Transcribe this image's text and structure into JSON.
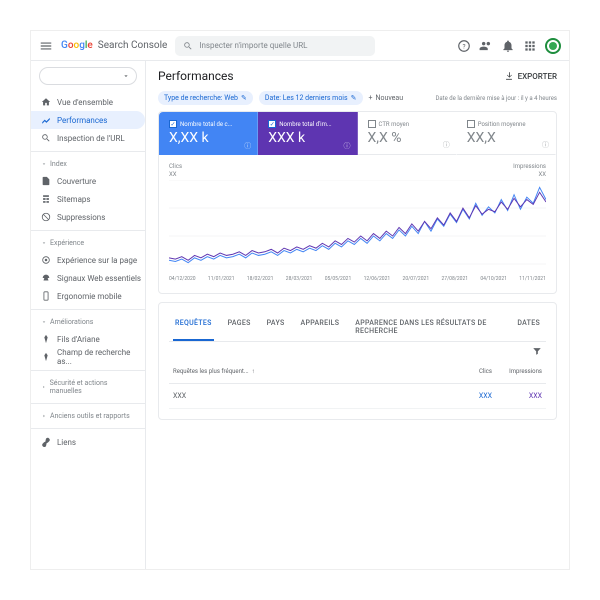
{
  "header": {
    "product": "Search Console",
    "search_placeholder": "Inspecter n'importe quelle URL"
  },
  "sidebar": {
    "items": [
      {
        "label": "Vue d'ensemble"
      },
      {
        "label": "Performances"
      },
      {
        "label": "Inspection de l'URL"
      }
    ],
    "sec_index": "Index",
    "index_items": [
      {
        "label": "Couverture"
      },
      {
        "label": "Sitemaps"
      },
      {
        "label": "Suppressions"
      }
    ],
    "sec_exp": "Expérience",
    "exp_items": [
      {
        "label": "Expérience sur la page"
      },
      {
        "label": "Signaux Web essentiels"
      },
      {
        "label": "Ergonomie mobile"
      }
    ],
    "sec_amel": "Améliorations",
    "amel_items": [
      {
        "label": "Fils d'Ariane"
      },
      {
        "label": "Champ de recherche as..."
      }
    ],
    "sec_sec": "Sécurité et actions manuelles",
    "sec_old": "Anciens outils et rapports",
    "liens": "Liens"
  },
  "page": {
    "title": "Performances",
    "export": "EXPORTER"
  },
  "filters": {
    "chips": [
      {
        "label": "Type de recherche: Web"
      },
      {
        "label": "Date: Les 12 derniers mois"
      }
    ],
    "new": "Nouveau",
    "updated": "Date de la dernière mise à jour : il y a 4 heures"
  },
  "metrics": [
    {
      "label": "Nombre total de c...",
      "value": "X,XX k",
      "checked": true
    },
    {
      "label": "Nombre total d'im...",
      "value": "XXX k",
      "checked": true
    },
    {
      "label": "CTR moyen",
      "value": "X,X %",
      "checked": false
    },
    {
      "label": "Position moyenne",
      "value": "XX,X",
      "checked": false
    }
  ],
  "chart_data": {
    "type": "line",
    "left_label": "Clics",
    "right_label": "Impressions",
    "left_unit": "XX",
    "right_unit": "XX",
    "x_ticks": [
      "04/12/2020",
      "11/01/2021",
      "18/02/2021",
      "28/03/2021",
      "05/05/2021",
      "12/06/2021",
      "20/07/2021",
      "27/08/2021",
      "04/10/2021",
      "11/11/2021"
    ],
    "series": [
      {
        "name": "Clics",
        "color": "#4285f4",
        "values": [
          8,
          7,
          9,
          6,
          10,
          8,
          11,
          9,
          12,
          10,
          11,
          13,
          10,
          14,
          12,
          13,
          15,
          12,
          16,
          14,
          17,
          15,
          18,
          16,
          20,
          17,
          22,
          19,
          24,
          21,
          26,
          22,
          28,
          24,
          30,
          26,
          33,
          28,
          36,
          30,
          40,
          32,
          42,
          36,
          46,
          39,
          50,
          42,
          55,
          45,
          52,
          47,
          58,
          49,
          62,
          50,
          60,
          55,
          68,
          58
        ]
      },
      {
        "name": "Impressions",
        "color": "#5e35b1",
        "values": [
          10,
          9,
          11,
          8,
          12,
          10,
          13,
          11,
          14,
          12,
          13,
          15,
          12,
          16,
          14,
          15,
          17,
          14,
          18,
          16,
          19,
          17,
          20,
          18,
          22,
          19,
          24,
          21,
          26,
          23,
          28,
          24,
          30,
          26,
          32,
          28,
          35,
          30,
          38,
          32,
          40,
          34,
          43,
          37,
          47,
          40,
          51,
          43,
          53,
          46,
          50,
          48,
          56,
          50,
          59,
          52,
          58,
          54,
          64,
          56
        ]
      }
    ],
    "ylim": [
      0,
      70
    ]
  },
  "tabs": [
    "REQUÊTES",
    "PAGES",
    "PAYS",
    "APPAREILS",
    "APPARENCE DANS LES RÉSULTATS DE RECHERCHE",
    "DATES"
  ],
  "table": {
    "h1": "Requêtes les plus fréquent...",
    "h2": "Clics",
    "h3": "Impressions",
    "rows": [
      {
        "q": "XXX",
        "c": "XXX",
        "i": "XXX"
      }
    ]
  }
}
